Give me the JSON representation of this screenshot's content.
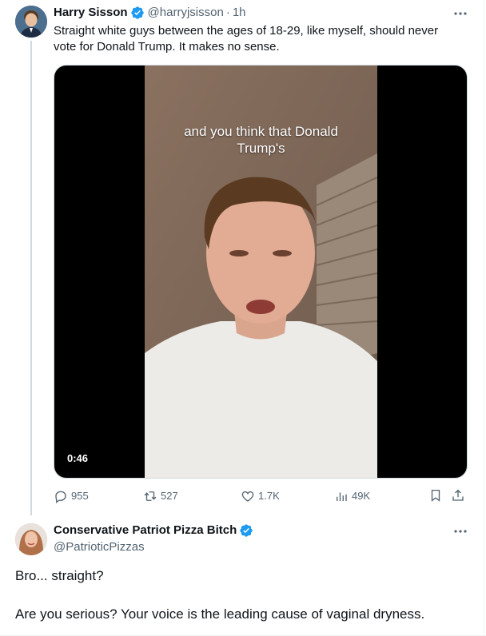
{
  "tweet": {
    "author_name": "Harry Sisson",
    "author_handle": "@harryjsisson",
    "separator": "·",
    "time": "1h",
    "text": "Straight white guys between the ages of 18-29, like myself, should never vote for Donald Trump. It makes no sense.",
    "media": {
      "caption_line1": "and you think that Donald",
      "caption_line2": "Trump's",
      "duration": "0:46"
    },
    "stats": {
      "replies": "955",
      "reposts": "527",
      "likes": "1.7K",
      "views": "49K"
    }
  },
  "reply": {
    "author_name": "Conservative Patriot Pizza Bitch",
    "author_handle": "@PatrioticPizzas",
    "paragraphs": [
      "Bro... straight?",
      "Are you serious? Your voice is the leading cause of vaginal dryness."
    ]
  },
  "colors": {
    "verified": "#1d9bf0",
    "secondary_text": "#536471",
    "thread_line": "#cfd9de"
  },
  "icons": [
    "verified-badge-icon",
    "more-icon",
    "reply-icon",
    "repost-icon",
    "like-icon",
    "views-icon",
    "bookmark-icon",
    "share-icon"
  ]
}
